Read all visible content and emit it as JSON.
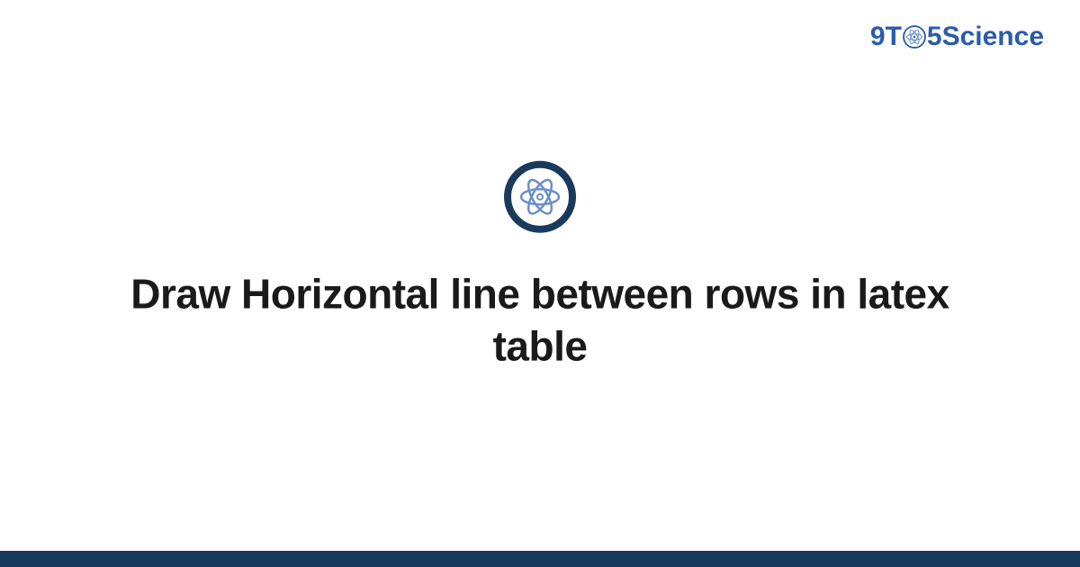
{
  "header": {
    "logo_prefix": "9T",
    "logo_suffix": "5Science"
  },
  "main": {
    "title": "Draw Horizontal line between rows in latex table"
  },
  "colors": {
    "brand_blue": "#2a5caa",
    "dark_navy": "#1a3a5c",
    "atom_light": "#6b8fc7"
  }
}
